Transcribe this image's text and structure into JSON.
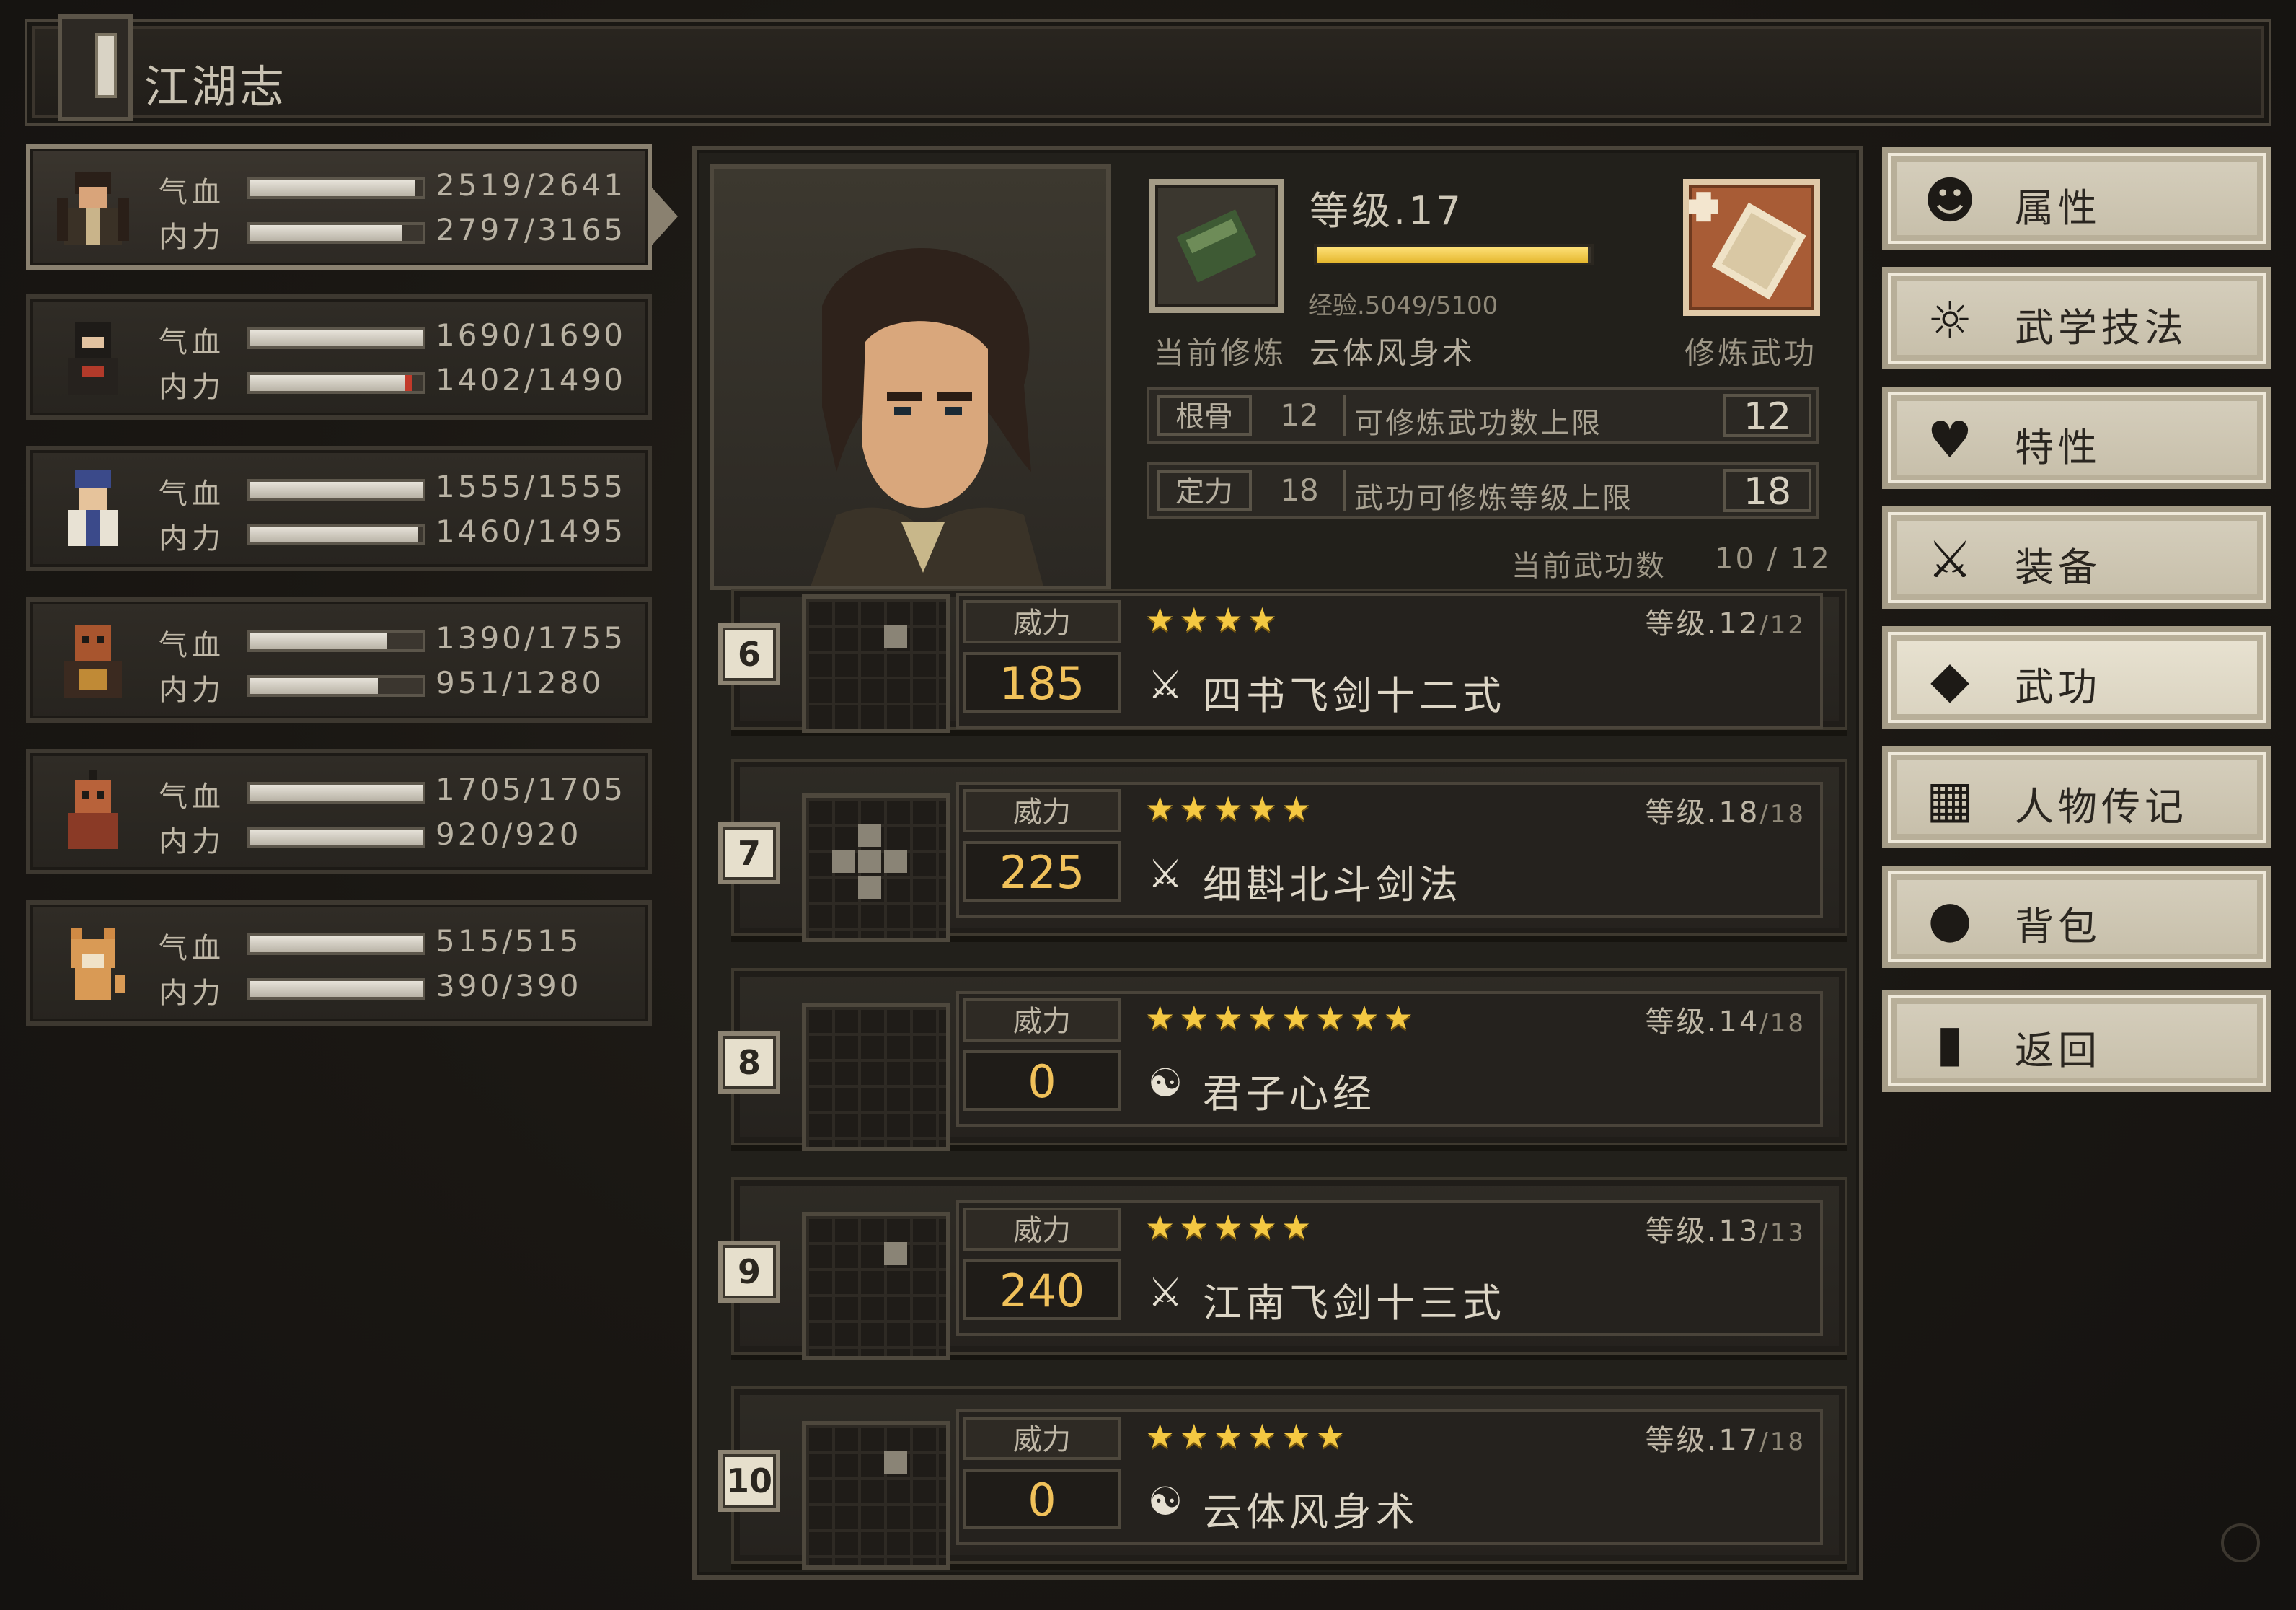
{
  "title": "江湖志",
  "party": [
    {
      "hp_label": "气血",
      "mp_label": "内力",
      "hp": "2519/2641",
      "mp": "2797/3165",
      "hp_ratio": 0.954,
      "mp_ratio": 0.884,
      "selected": true
    },
    {
      "hp_label": "气血",
      "mp_label": "内力",
      "hp": "1690/1690",
      "mp": "1402/1490",
      "hp_ratio": 1.0,
      "mp_ratio": 0.941,
      "selected": false
    },
    {
      "hp_label": "气血",
      "mp_label": "内力",
      "hp": "1555/1555",
      "mp": "1460/1495",
      "hp_ratio": 1.0,
      "mp_ratio": 0.977,
      "selected": false
    },
    {
      "hp_label": "气血",
      "mp_label": "内力",
      "hp": "1390/1755",
      "mp": "951/1280",
      "hp_ratio": 0.792,
      "mp_ratio": 0.743,
      "selected": false
    },
    {
      "hp_label": "气血",
      "mp_label": "内力",
      "hp": "1705/1705",
      "mp": "920/920",
      "hp_ratio": 1.0,
      "mp_ratio": 1.0,
      "selected": false
    },
    {
      "hp_label": "气血",
      "mp_label": "内力",
      "hp": "515/515",
      "mp": "390/390",
      "hp_ratio": 1.0,
      "mp_ratio": 1.0,
      "selected": false
    }
  ],
  "character": {
    "level_text": "等级.17",
    "exp_text": "经验.5049/5100",
    "exp_ratio": 0.99,
    "current_label": "当前修炼",
    "current_value": "云体风身术",
    "cultivate_label": "修炼武功",
    "stats": [
      {
        "key": "根骨",
        "value": "12",
        "desc": "可修炼武功数上限",
        "max": "12"
      },
      {
        "key": "定力",
        "value": "18",
        "desc": "武功可修炼等级上限",
        "max": "18"
      }
    ],
    "slots_label": "当前武功数",
    "slots_value": "10 / 12"
  },
  "skills": [
    {
      "index": "6",
      "power_label": "威力",
      "power": "185",
      "stars": "★★★★",
      "level": "等级.12",
      "level_max": "/12",
      "type_icon": "sword-icon",
      "name": "四书飞剑十二式"
    },
    {
      "index": "7",
      "power_label": "威力",
      "power": "225",
      "stars": "★★★★★",
      "level": "等级.18",
      "level_max": "/18",
      "type_icon": "sword-icon",
      "name": "细斟北斗剑法"
    },
    {
      "index": "8",
      "power_label": "威力",
      "power": "0",
      "stars": "★★★★★★★★",
      "level": "等级.14",
      "level_max": "/18",
      "type_icon": "yin-yang-icon",
      "name": "君子心经"
    },
    {
      "index": "9",
      "power_label": "威力",
      "power": "240",
      "stars": "★★★★★",
      "level": "等级.13",
      "level_max": "/13",
      "type_icon": "sword-icon",
      "name": "江南飞剑十三式"
    },
    {
      "index": "10",
      "power_label": "威力",
      "power": "0",
      "stars": "★★★★★★",
      "level": "等级.17",
      "level_max": "/18",
      "type_icon": "yin-yang-icon",
      "name": "云体风身术"
    }
  ],
  "menu": [
    {
      "label": "属性",
      "icon": "person-icon"
    },
    {
      "label": "武学技法",
      "icon": "martial-person-icon"
    },
    {
      "label": "特性",
      "icon": "trait-icon"
    },
    {
      "label": "装备",
      "icon": "sword-icon"
    },
    {
      "label": "武功",
      "icon": "book-icon"
    },
    {
      "label": "人物传记",
      "icon": "scroll-icon"
    },
    {
      "label": "背包",
      "icon": "bag-icon"
    },
    {
      "label": "返回",
      "icon": "door-icon"
    }
  ]
}
